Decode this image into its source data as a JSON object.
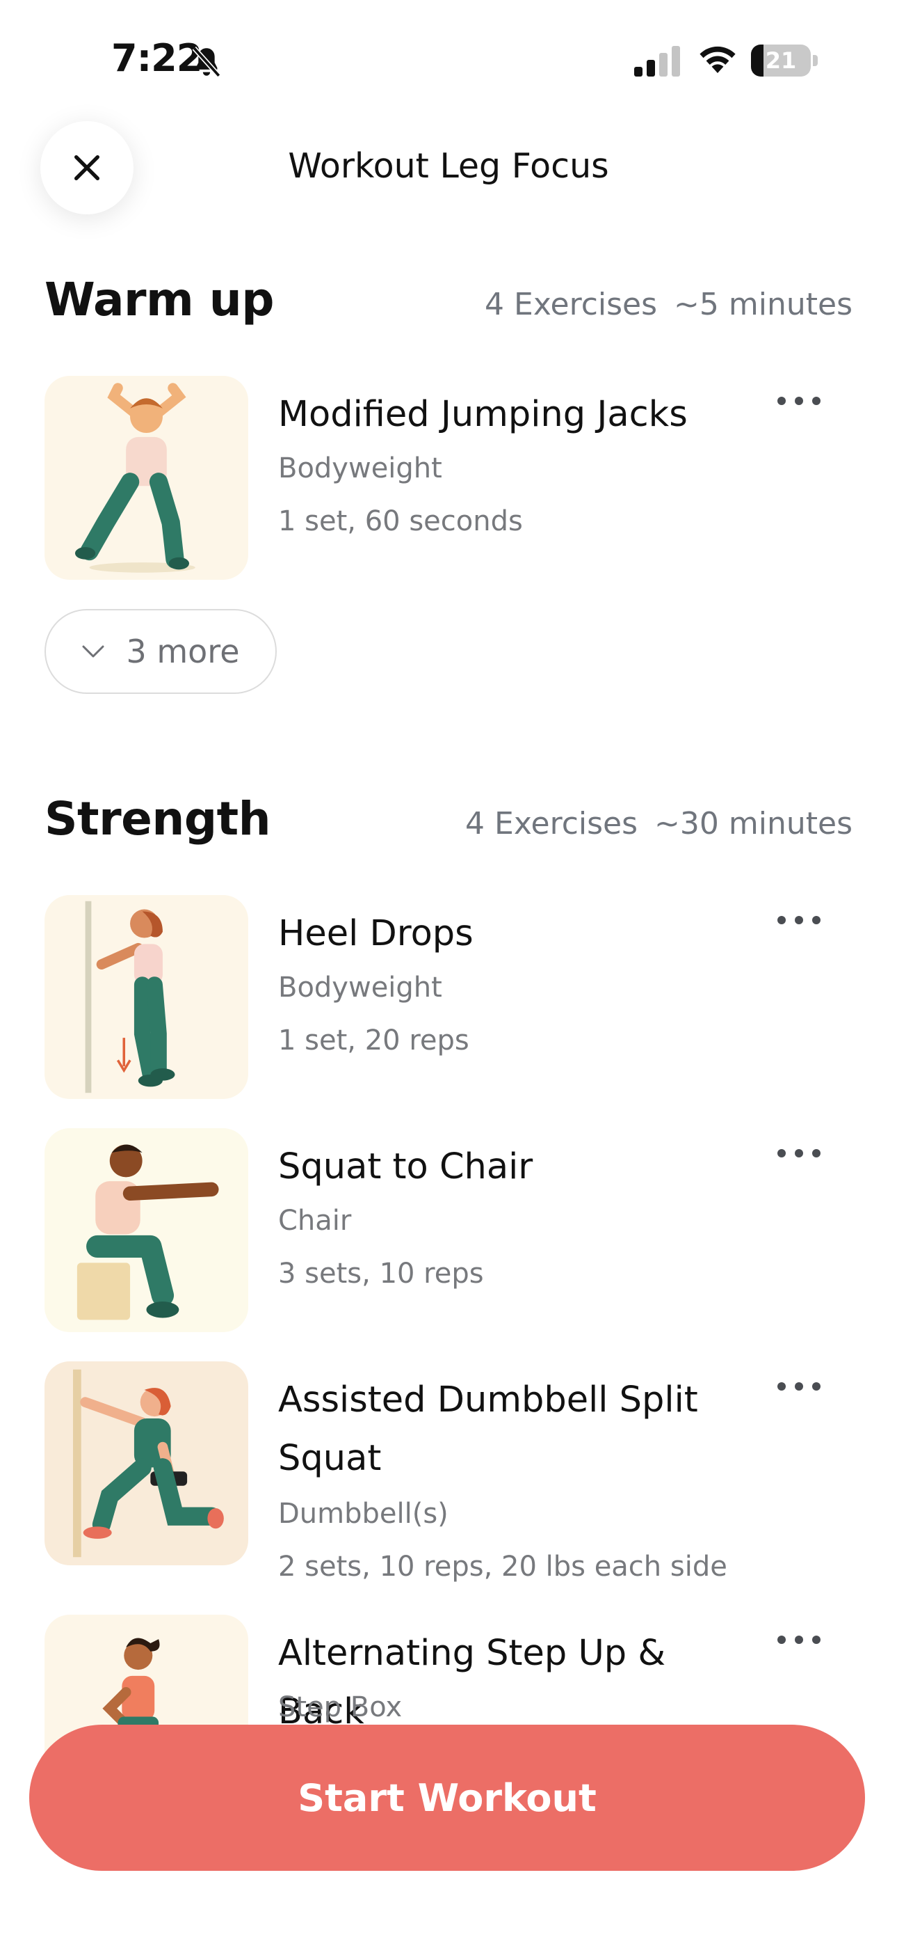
{
  "status_bar": {
    "time": "7:22",
    "battery_level": "21",
    "icons": [
      "bell-slash-icon",
      "cellular-signal-icon",
      "wifi-icon",
      "battery-icon"
    ]
  },
  "header": {
    "close_icon": "close-icon",
    "title": "Workout Leg Focus"
  },
  "sections": [
    {
      "title": "Warm up",
      "exercise_count": "4 Exercises",
      "duration": "~5 minutes",
      "exercises": [
        {
          "name": "Modified Jumping Jacks",
          "equipment": "Bodyweight",
          "detail": "1 set, 60 seconds"
        }
      ],
      "expand_label": "3 more"
    },
    {
      "title": "Strength",
      "exercise_count": "4 Exercises",
      "duration": "~30 minutes",
      "exercises": [
        {
          "name": "Heel Drops",
          "equipment": "Bodyweight",
          "detail": "1 set, 20 reps"
        },
        {
          "name": "Squat to Chair",
          "equipment": "Chair",
          "detail": "3 sets, 10 reps"
        },
        {
          "name": "Assisted Dumbbell Split Squat",
          "equipment": "Dumbbell(s)",
          "detail": "2 sets, 10 reps, 20 lbs each side"
        },
        {
          "name": "Alternating Step Up & Back",
          "equipment": "Step Box",
          "detail": ""
        }
      ]
    }
  ],
  "start_button": {
    "label": "Start Workout"
  },
  "colors": {
    "accent": "#ec6e66",
    "muted_text": "#77797d",
    "thumbnail_bg": "#fdf6e8"
  }
}
